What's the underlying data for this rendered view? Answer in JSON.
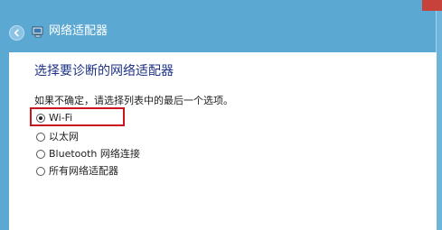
{
  "window": {
    "title": "网络适配器"
  },
  "content": {
    "heading": "选择要诊断的网络适配器",
    "description": "如果不确定，请选择列表中的最后一个选项。",
    "options": [
      {
        "label": "Wi-Fi",
        "selected": true
      },
      {
        "label": "以太网",
        "selected": false
      },
      {
        "label": "Bluetooth 网络连接",
        "selected": false
      },
      {
        "label": "所有网络适配器",
        "selected": false
      }
    ]
  },
  "colors": {
    "title_bar": "#5ba8d2",
    "heading_text": "#1e3287",
    "highlight_border": "#c9151c"
  },
  "icons": {
    "back": "back-arrow-icon",
    "title": "troubleshooter-icon"
  }
}
